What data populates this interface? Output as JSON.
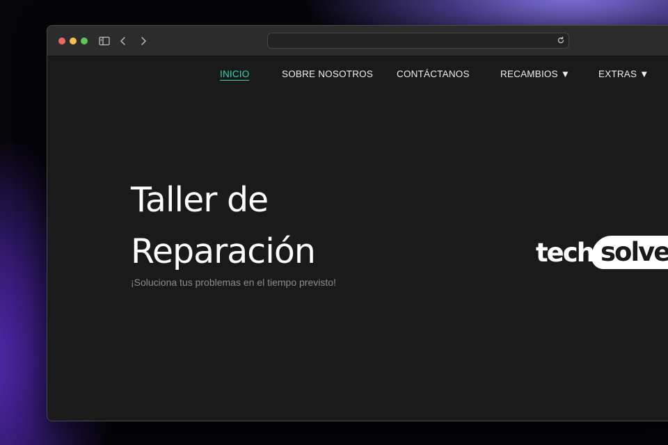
{
  "browser": {
    "url": "",
    "controls": {
      "close": "close-dot",
      "minimize": "minimize-dot",
      "zoom": "zoom-dot",
      "sidebar": "sidebar-icon",
      "back": "chevron-left-icon",
      "forward": "chevron-right-icon",
      "reload": "reload-icon"
    }
  },
  "nav": {
    "items": [
      {
        "label": "INICIO",
        "active": true
      },
      {
        "label": "SOBRE NOSOTROS",
        "active": false
      },
      {
        "label": "CONTÁCTANOS",
        "active": false
      },
      {
        "label": "RECAMBIOS ▼",
        "active": false
      },
      {
        "label": "EXTRAS ▼",
        "active": false
      }
    ]
  },
  "hero": {
    "title_line1": "Taller de",
    "title_line2": "Reparación",
    "subtitle": "¡Soluciona tus problemas en el tiempo previsto!"
  },
  "logo": {
    "part1": "tech",
    "part2": "solve"
  },
  "colors": {
    "accent": "#2fd6b4",
    "page_bg": "#1a1a1a",
    "text": "#ffffff",
    "subtitle": "#8c8c8c"
  }
}
